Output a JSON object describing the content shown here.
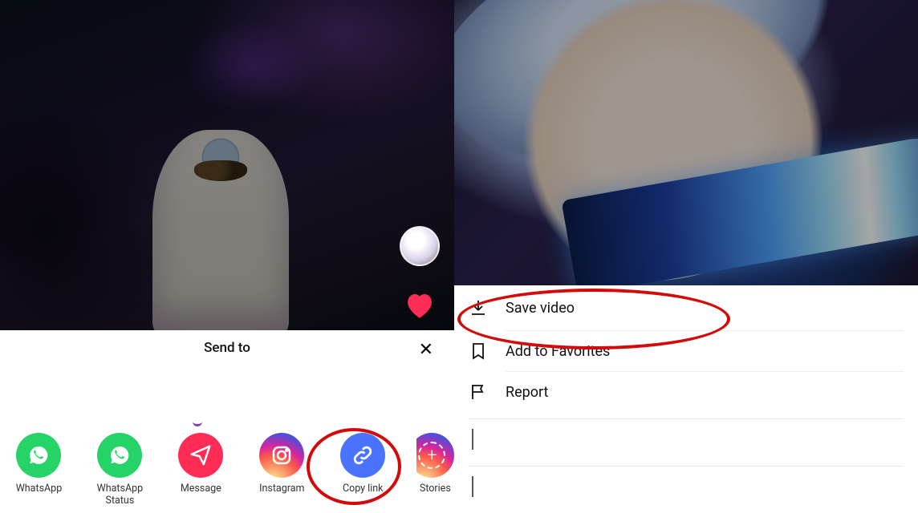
{
  "left": {
    "share_sheet_title": "Send to",
    "close_symbol": "✕",
    "items": [
      {
        "label": "WhatsApp"
      },
      {
        "label": "WhatsApp Status"
      },
      {
        "label": "Message"
      },
      {
        "label": "Instagram"
      },
      {
        "label": "Copy link"
      },
      {
        "label": "Stories"
      }
    ]
  },
  "right": {
    "menu": [
      {
        "label": "Save video"
      },
      {
        "label": "Add to Favorites"
      },
      {
        "label": "Report"
      }
    ]
  },
  "annotations": {
    "copy_link_highlight": true,
    "save_video_highlight": true
  }
}
